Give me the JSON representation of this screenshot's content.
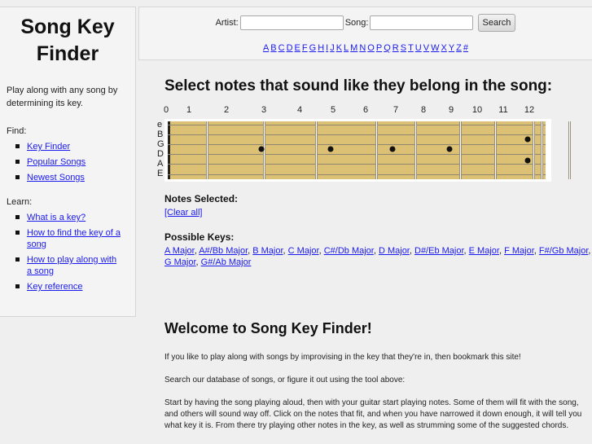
{
  "sidebar": {
    "logo_line1": "Song Key",
    "logo_line2": "Finder",
    "tagline": "Play along with any song by determining its key.",
    "find_heading": "Find:",
    "find_links": [
      "Key Finder",
      "Popular Songs",
      "Newest Songs"
    ],
    "learn_heading": "Learn:",
    "learn_links": [
      "What is a key?",
      "How to find the key of a song",
      "How to play along with a song",
      "Key reference"
    ]
  },
  "header": {
    "artist_label": "Artist:",
    "artist_value": "",
    "song_label": "Song:",
    "song_value": "",
    "search_button": "Search",
    "alphabet": [
      "A",
      "B",
      "C",
      "D",
      "E",
      "F",
      "G",
      "H",
      "I",
      "J",
      "K",
      "L",
      "M",
      "N",
      "O",
      "P",
      "Q",
      "R",
      "S",
      "T",
      "U",
      "V",
      "W",
      "X",
      "Y",
      "Z",
      "#"
    ]
  },
  "main": {
    "heading": "Select notes that sound like they belong in the song:",
    "fret_numbers": [
      "0",
      "1",
      "2",
      "3",
      "4",
      "5",
      "6",
      "7",
      "8",
      "9",
      "10",
      "11",
      "12"
    ],
    "string_labels": [
      "e",
      "B",
      "G",
      "D",
      "A",
      "E"
    ],
    "inlay_markers": [
      {
        "fret": 3,
        "string": "D"
      },
      {
        "fret": 5,
        "string": "D"
      },
      {
        "fret": 7,
        "string": "D"
      },
      {
        "fret": 9,
        "string": "D"
      },
      {
        "fret": 12,
        "string": "B"
      },
      {
        "fret": 12,
        "string": "A"
      }
    ],
    "notes_selected_heading": "Notes Selected:",
    "clear_all": "[Clear all]",
    "possible_keys_heading": "Possible Keys:",
    "possible_keys": [
      "A Major",
      "A#/Bb Major",
      "B Major",
      "C Major",
      "C#/Db Major",
      "D Major",
      "D#/Eb Major",
      "E Major",
      "F Major",
      "F#/Gb Major",
      "G Major",
      "G#/Ab Major"
    ],
    "welcome_heading": "Welcome to Song Key Finder!",
    "paragraphs": [
      "If you like to play along with songs by improvising in the key that they're in, then bookmark this site!",
      "Search our database of songs, or figure it out using the tool above:",
      "Start by having the song playing aloud, then with your guitar start playing notes. Some of them will fit with the song, and others will sound way off. Click on the notes that fit, and when you have narrowed it down enough, it will tell you what key it is. From there try playing other notes in the key, as well as strumming some of the suggested chords."
    ]
  }
}
